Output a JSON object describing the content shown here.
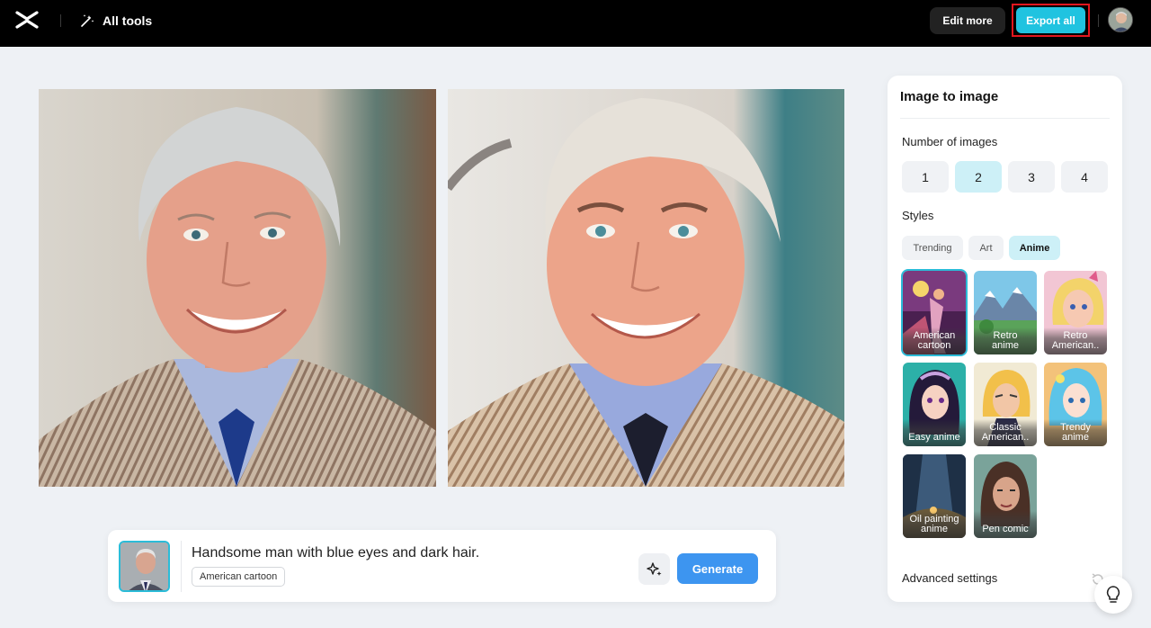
{
  "header": {
    "all_tools_label": "All tools",
    "edit_more_label": "Edit more",
    "export_all_label": "Export all"
  },
  "prompt": {
    "text": "Handsome man with blue eyes and dark hair.",
    "style_chip": "American cartoon",
    "generate_label": "Generate"
  },
  "panel": {
    "title": "Image to image",
    "number_label": "Number of images",
    "number_options": [
      "1",
      "2",
      "3",
      "4"
    ],
    "number_selected": "2",
    "styles_label": "Styles",
    "style_tabs": [
      "Trending",
      "Art",
      "Anime"
    ],
    "style_tab_selected": "Anime",
    "style_cards": [
      {
        "label": "American cartoon",
        "line1": "American",
        "line2": "cartoon"
      },
      {
        "label": "Retro anime",
        "line1": "Retro",
        "line2": "anime"
      },
      {
        "label": "Retro American..",
        "line1": "Retro",
        "line2": "American.."
      },
      {
        "label": "Easy anime",
        "line1": "Easy anime",
        "line2": ""
      },
      {
        "label": "Classic American..",
        "line1": "Classic",
        "line2": "American.."
      },
      {
        "label": "Trendy anime",
        "line1": "Trendy",
        "line2": "anime"
      },
      {
        "label": "Oil painting anime",
        "line1": "Oil painting",
        "line2": "anime"
      },
      {
        "label": "Pen comic",
        "line1": "Pen comic",
        "line2": ""
      }
    ],
    "style_selected": "American cartoon",
    "advanced_label": "Advanced settings"
  },
  "colors": {
    "accent": "#20c3e0",
    "generate": "#3d95f0",
    "highlight_box": "#e1161e",
    "selected_bg": "#cdf0f7"
  },
  "icons": {
    "logo": "capcut-logo-icon",
    "all_tools": "magic-wand-icon",
    "enhance": "sparkle-icon",
    "help": "lightbulb-icon",
    "reset": "reset-icon"
  }
}
